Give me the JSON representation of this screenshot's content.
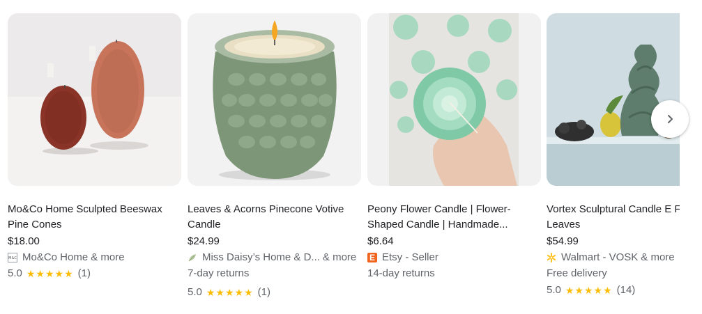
{
  "products": [
    {
      "title": "Mo&Co Home Sculpted Beeswax Pine Cones",
      "price": "$18.00",
      "seller": "Mo&Co Home",
      "more": "& more",
      "rating": "5.0",
      "stars": "★★★★★",
      "reviews": "(1)",
      "favicon": "moco-logo-icon"
    },
    {
      "title": "Leaves & Acorns Pinecone Votive Candle",
      "price": "$24.99",
      "seller": "Miss Daisy’s Home & D...",
      "more": "& more",
      "extra": "7-day returns",
      "rating": "5.0",
      "stars": "★★★★★",
      "reviews": "(1)",
      "favicon": "leaf-icon"
    },
    {
      "title": "Peony Flower Candle | Flower-Shaped Candle | Handmade...",
      "price": "$6.64",
      "seller": "Etsy - Seller",
      "extra": "14-day returns",
      "favicon": "etsy-icon",
      "favicon_letter": "E"
    },
    {
      "title": "Vortex Sculptural Candle E Forest Leaves",
      "price": "$54.99",
      "seller": "Walmart - VOSK",
      "more": "& more",
      "extra": "Free delivery",
      "rating": "5.0",
      "stars": "★★★★★",
      "reviews": "(14)",
      "favicon": "walmart-spark-icon"
    }
  ],
  "colors": {
    "star": "#fbbc04",
    "etsy": "#f1641e",
    "walmart": "#ffc220",
    "text_secondary": "#5f6368"
  },
  "next_button_icon": "chevron-right-icon"
}
